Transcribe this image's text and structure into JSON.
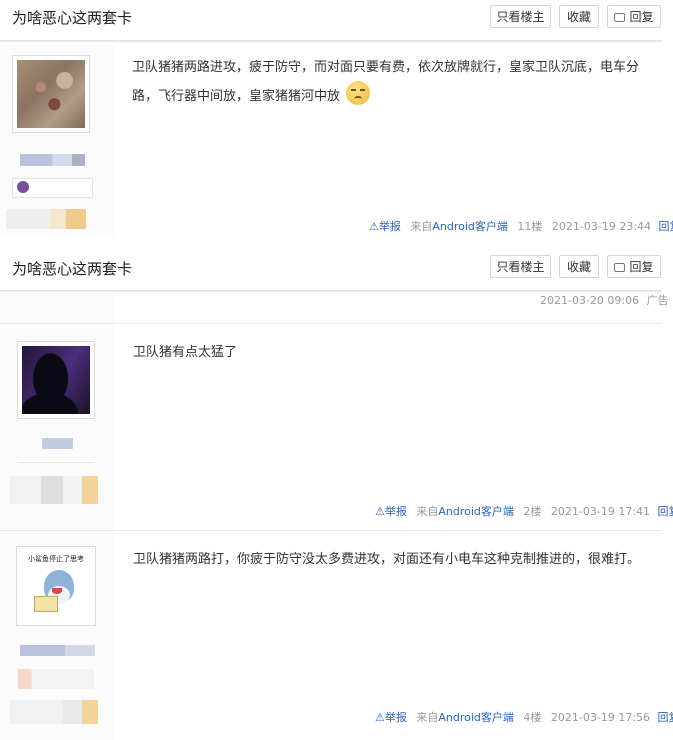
{
  "thread": {
    "title": "为啥恶心这两套卡",
    "buttons": {
      "only_op": "只看楼主",
      "favorite": "收藏",
      "reply": "回复"
    }
  },
  "ad_tail": {
    "time": "2021-03-20 09:06",
    "label": "广告"
  },
  "posts": [
    {
      "content": "卫队猪猪两路进攻，疲于防守，而对面只要有费，依次放牌就行，皇家卫队沉底，电车分路，飞行器中间放，皇家猪猪河中放",
      "emoji": "sad-face",
      "report": "举报",
      "source_prefix": "来自",
      "source_client": "Android客户端",
      "floor": "11楼",
      "time": "2021-03-19 23:44",
      "reply": "回复"
    },
    {
      "content": "卫队猪有点太猛了",
      "report": "举报",
      "source_prefix": "来自",
      "source_client": "Android客户端",
      "floor": "2楼",
      "time": "2021-03-19 17:41",
      "reply": "回复"
    },
    {
      "content": "卫队猪猪两路打，你疲于防守没太多费进攻，对面还有小电车这种克制推进的，很难打。",
      "avatar_caption": "小鲨鱼停止了思考",
      "report": "举报",
      "source_prefix": "来自",
      "source_client": "Android客户端",
      "floor": "4楼",
      "time": "2021-03-19 17:56",
      "reply": "回复"
    }
  ],
  "colors": {
    "link": "#2d64b3",
    "meta": "#999999",
    "text": "#333333"
  }
}
